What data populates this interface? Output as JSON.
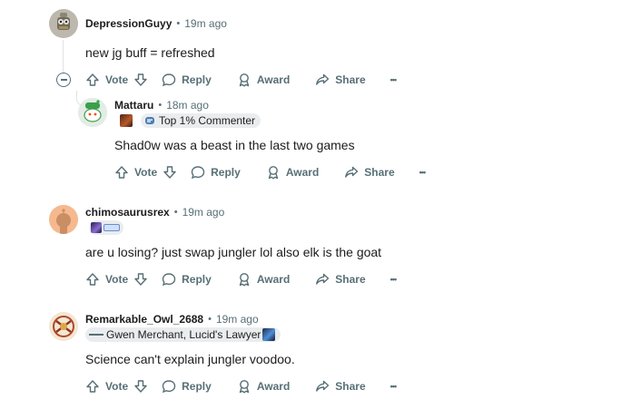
{
  "actions": {
    "vote": "Vote",
    "reply": "Reply",
    "award": "Award",
    "share": "Share",
    "more": "•••"
  },
  "comments": [
    {
      "author": "DepressionGuyy",
      "time": "19m ago",
      "text": "new jg buff = refreshed"
    },
    {
      "author": "Mattaru",
      "time": "18m ago",
      "flair": "Top 1% Commenter",
      "text": "Shad0w was a beast in the last two games"
    },
    {
      "author": "chimosaurusrex",
      "time": "19m ago",
      "text": "are u losing? just swap jungler lol also elk is the goat"
    },
    {
      "author": "Remarkable_Owl_2688",
      "time": "19m ago",
      "flair": "Gwen Merchant, Lucid's Lawyer",
      "text": "Science can't explain jungler voodoo."
    }
  ],
  "colors": {
    "meta_gray": "#576f76",
    "thread_line": "#dfe3e6",
    "flair_bg": "#eaedef"
  }
}
